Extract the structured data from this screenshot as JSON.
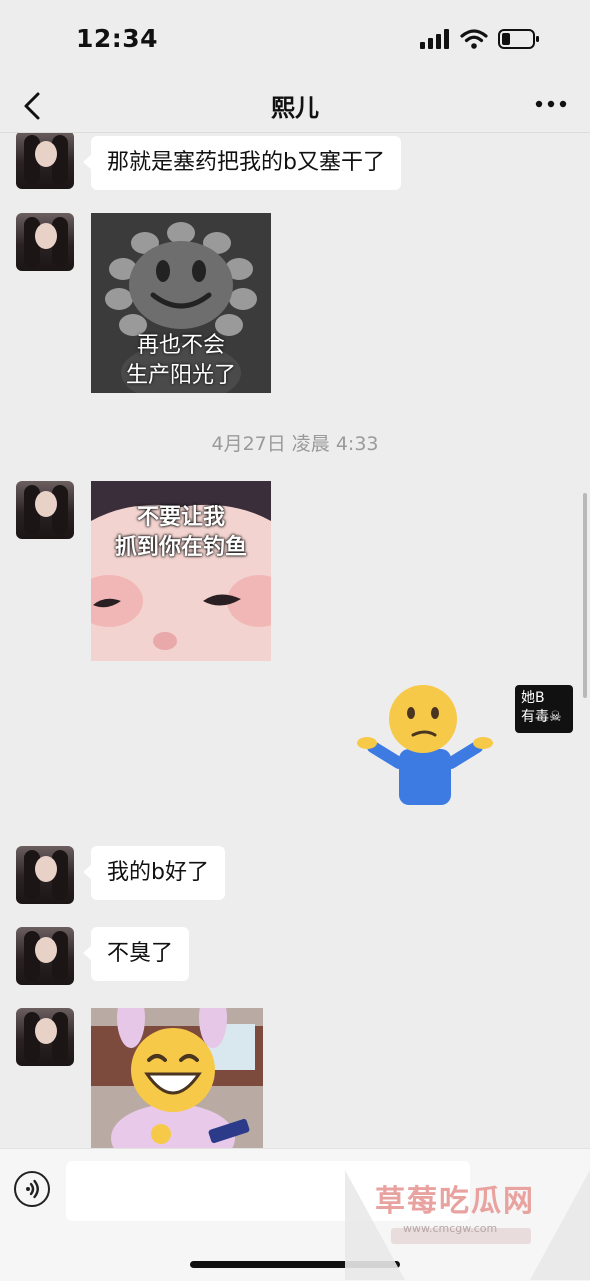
{
  "status_bar": {
    "time": "12:34"
  },
  "nav": {
    "title": "熙儿"
  },
  "messages": {
    "m1": "那就是塞药把我的b又塞干了",
    "sticker_sunflower_caption": [
      "再也不会",
      "生产阳光了"
    ],
    "time_divider": "4月27日 凌晨 4:33",
    "sticker_baby_caption": [
      "不要让我",
      "抓到你在钓鱼"
    ],
    "sticker_shrug_label": [
      "她B",
      "有毒☠"
    ],
    "m2": "我的b好了",
    "m3": "不臭了"
  },
  "input": {
    "placeholder": ""
  },
  "watermark": {
    "title": "草莓吃瓜网",
    "url": "www.cmcgw.com"
  }
}
